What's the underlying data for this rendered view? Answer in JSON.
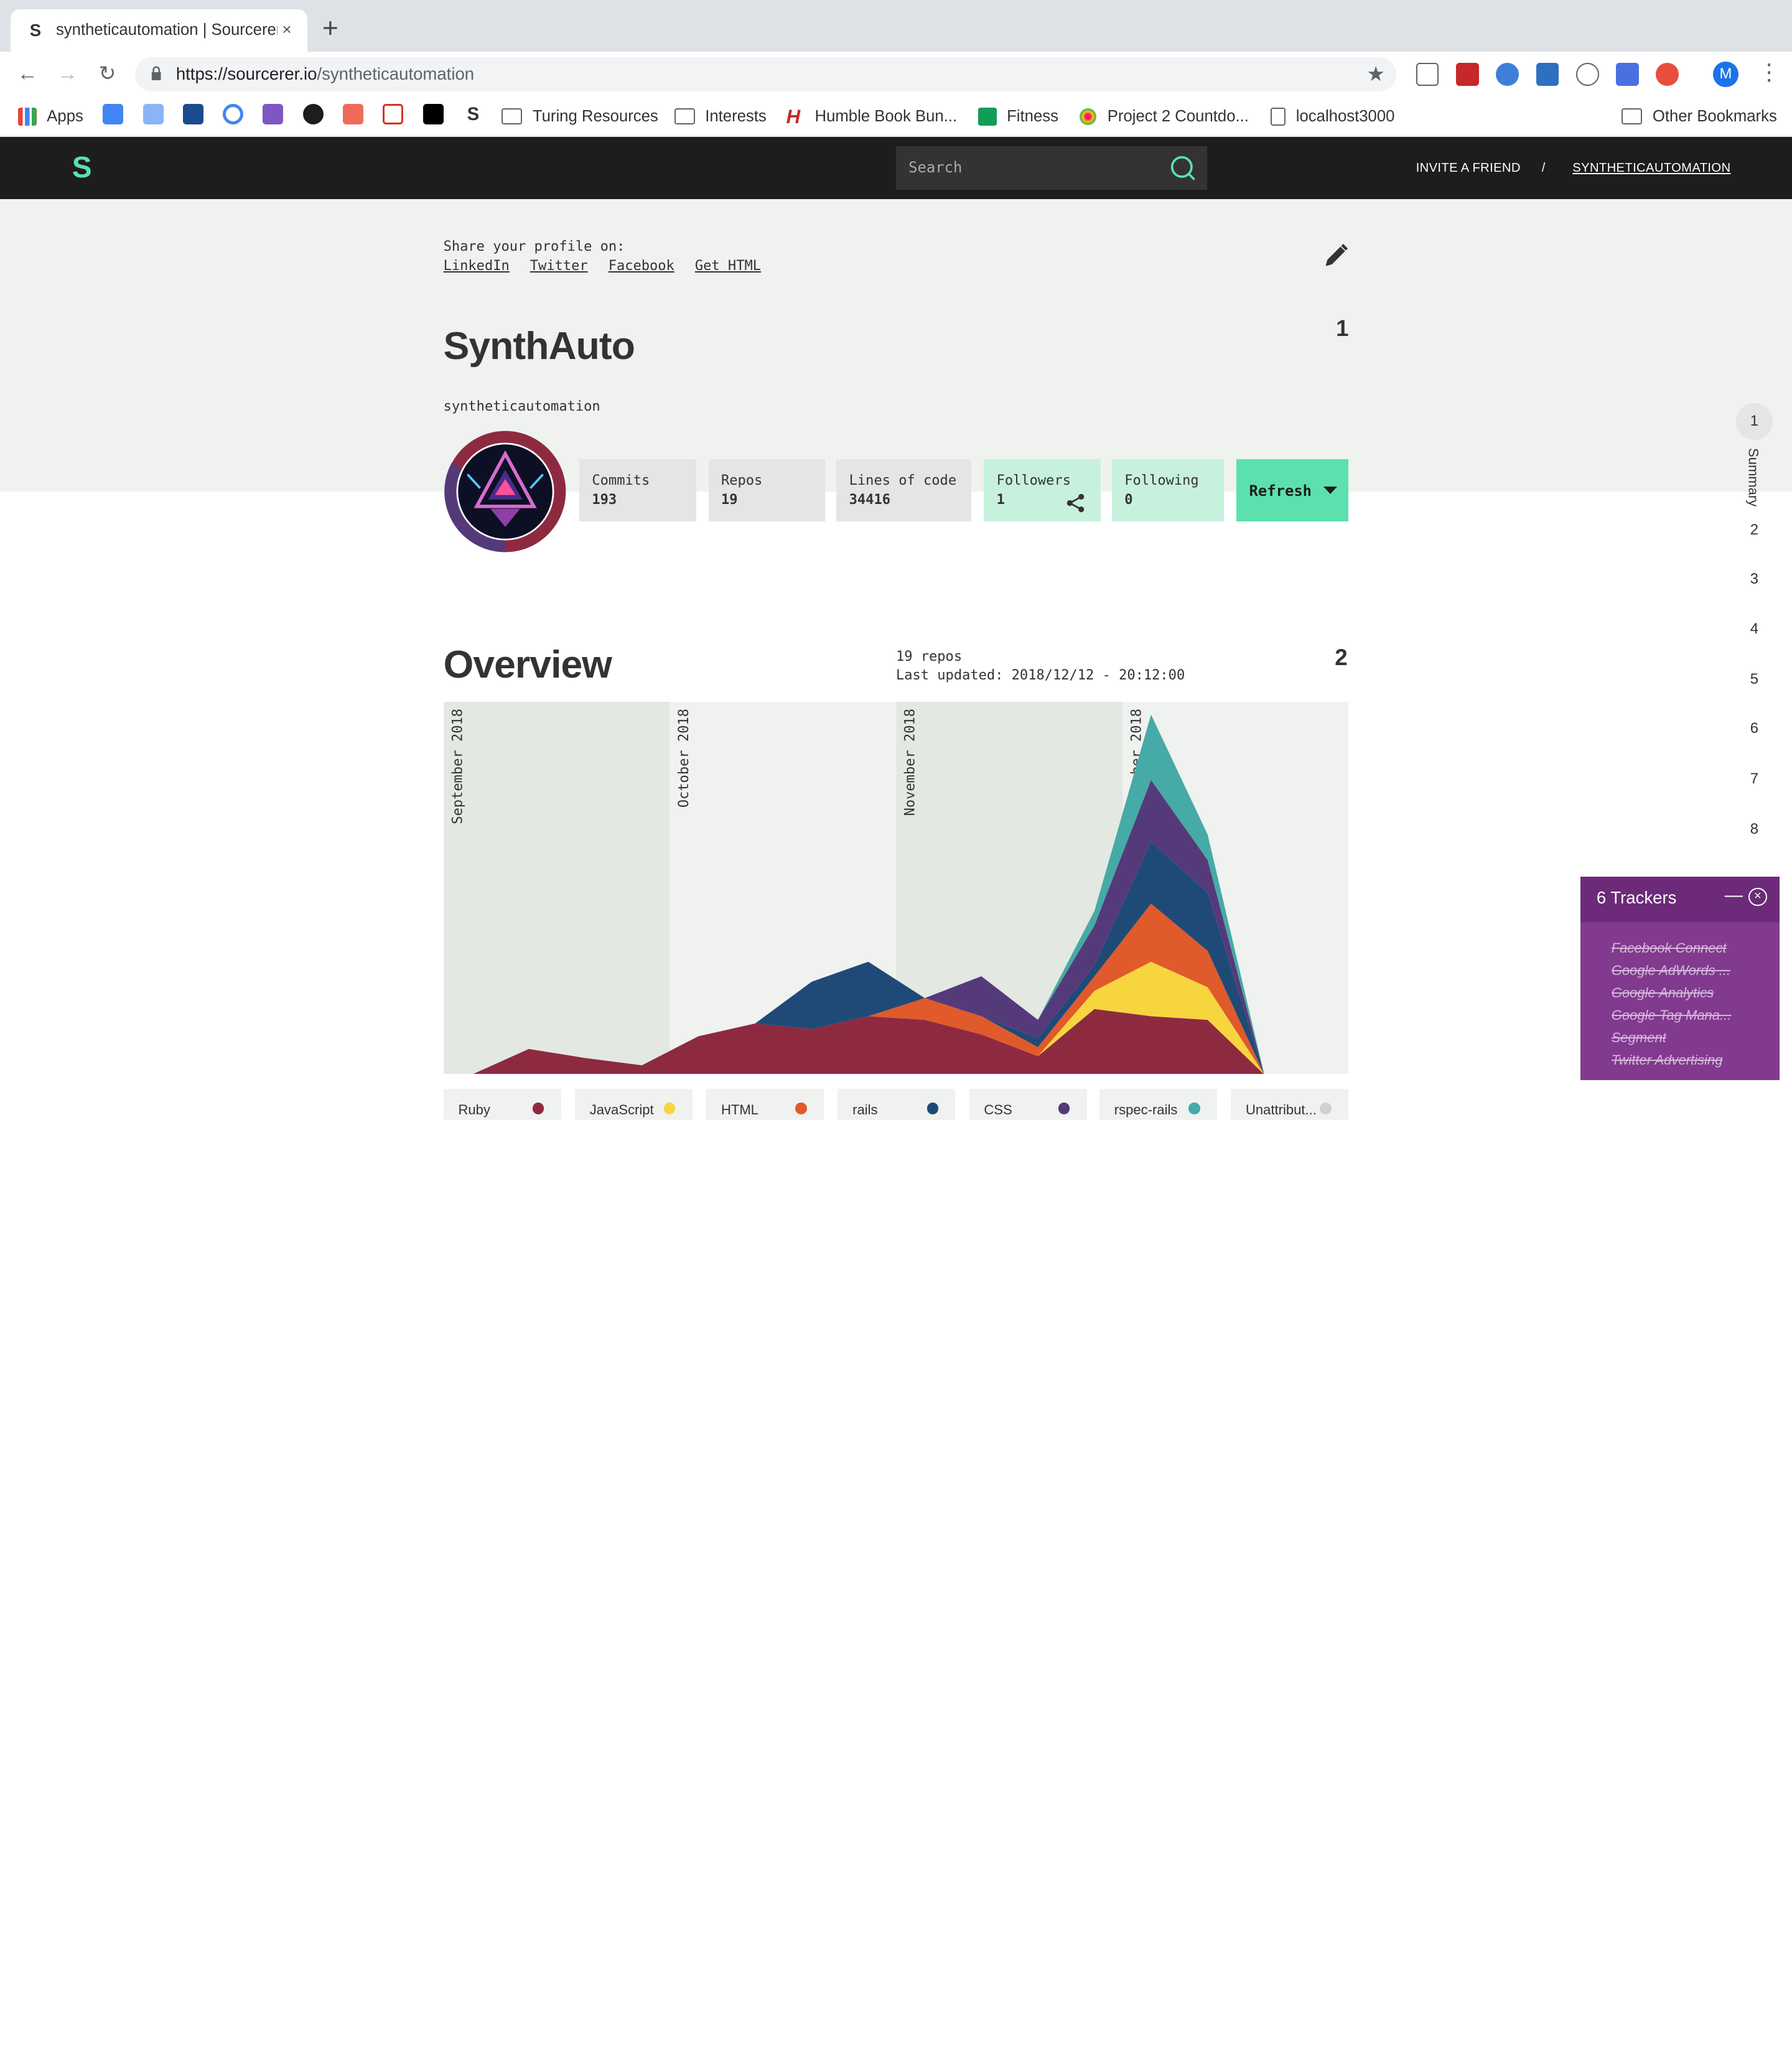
{
  "browser": {
    "tab_title": "syntheticautomation | Sourcerer",
    "tab_close": "×",
    "new_tab": "+",
    "url_host": "https://sourcerer.io",
    "url_path": "/syntheticautomation",
    "profile_initial": "M",
    "bookmarks": [
      {
        "label": "Apps",
        "icon": "apps-grid-icon"
      },
      {
        "label": "Turing Resources",
        "icon": "folder-icon"
      },
      {
        "label": "Interests",
        "icon": "folder-icon"
      },
      {
        "label": "Humble Book Bun...",
        "icon": "humble-icon"
      },
      {
        "label": "Fitness",
        "icon": "sheets-icon"
      },
      {
        "label": "Project 2 Countdo...",
        "icon": "sparkle-icon"
      },
      {
        "label": "localhost3000",
        "icon": "page-icon"
      },
      {
        "label": "Other Bookmarks",
        "icon": "folder-icon"
      }
    ]
  },
  "site": {
    "search_placeholder": "Search",
    "invite": "INVITE A FRIEND",
    "separator": "/",
    "username_link": "SYNTHETICAUTOMATION",
    "accent": "#5ce0ae"
  },
  "profile": {
    "share_label": "Share your profile on:",
    "share_links": [
      "LinkedIn",
      "Twitter",
      "Facebook",
      "Get HTML"
    ],
    "section_number": "1",
    "name": "SynthAuto",
    "username": "syntheticautomation",
    "stats": [
      {
        "label": "Commits",
        "value": "193"
      },
      {
        "label": "Repos",
        "value": "19"
      },
      {
        "label": "Lines of code",
        "value": "34416"
      },
      {
        "label": "Followers",
        "value": "1"
      },
      {
        "label": "Following",
        "value": "0"
      }
    ],
    "refresh_label": "Refresh"
  },
  "section_nav": {
    "items": [
      "1",
      "2",
      "3",
      "4",
      "5",
      "6",
      "7",
      "8"
    ],
    "active_label": "Summary"
  },
  "overview": {
    "title": "Overview",
    "section_number": "2",
    "repos": "19 repos",
    "last_updated": "Last updated: 2018/12/12 - 20:12:00",
    "legend": [
      {
        "name": "Ruby",
        "color": "#8e2a40"
      },
      {
        "name": "JavaScript",
        "color": "#f6d53e"
      },
      {
        "name": "HTML",
        "color": "#e05a2b"
      },
      {
        "name": "rails",
        "color": "#1f4a78"
      },
      {
        "name": "CSS",
        "color": "#553a7a"
      },
      {
        "name": "rspec-rails",
        "color": "#46aaa6"
      },
      {
        "name": "Unattribut...",
        "color": "#d0d0d0"
      }
    ]
  },
  "chart_data": {
    "type": "area",
    "x_month_labels": [
      "September 2018",
      "October 2018",
      "November 2018",
      "December 2018"
    ],
    "x": [
      0,
      1,
      2,
      3,
      4,
      5,
      6,
      7,
      8,
      9,
      10,
      11,
      12,
      13,
      14
    ],
    "series": [
      {
        "name": "Ruby",
        "values": [
          0,
          14,
          9,
          5,
          21,
          28,
          25,
          32,
          30,
          22,
          10,
          36,
          32,
          30,
          0
        ]
      },
      {
        "name": "JavaScript",
        "values": [
          0,
          0,
          0,
          0,
          0,
          0,
          0,
          0,
          0,
          0,
          0,
          10,
          30,
          18,
          0
        ]
      },
      {
        "name": "HTML",
        "values": [
          0,
          0,
          0,
          0,
          0,
          0,
          0,
          0,
          12,
          10,
          5,
          8,
          32,
          20,
          0
        ]
      },
      {
        "name": "rails",
        "values": [
          0,
          0,
          0,
          0,
          0,
          0,
          26,
          30,
          0,
          0,
          5,
          6,
          34,
          32,
          0
        ]
      },
      {
        "name": "CSS",
        "values": [
          0,
          0,
          0,
          0,
          0,
          0,
          0,
          0,
          0,
          22,
          10,
          22,
          34,
          18,
          0
        ]
      },
      {
        "name": "rspec-rails",
        "values": [
          0,
          0,
          0,
          0,
          0,
          0,
          0,
          0,
          0,
          0,
          0,
          8,
          36,
          14,
          0
        ]
      }
    ]
  },
  "trackers": {
    "title": "6 Trackers",
    "minimize": "—",
    "close": "×",
    "items": [
      "Facebook Connect",
      "Google AdWords ...",
      "Google Analytics",
      "Google Tag Mana...",
      "Segment",
      "Twitter Advertising"
    ],
    "bg_color": "#6c2a78"
  }
}
